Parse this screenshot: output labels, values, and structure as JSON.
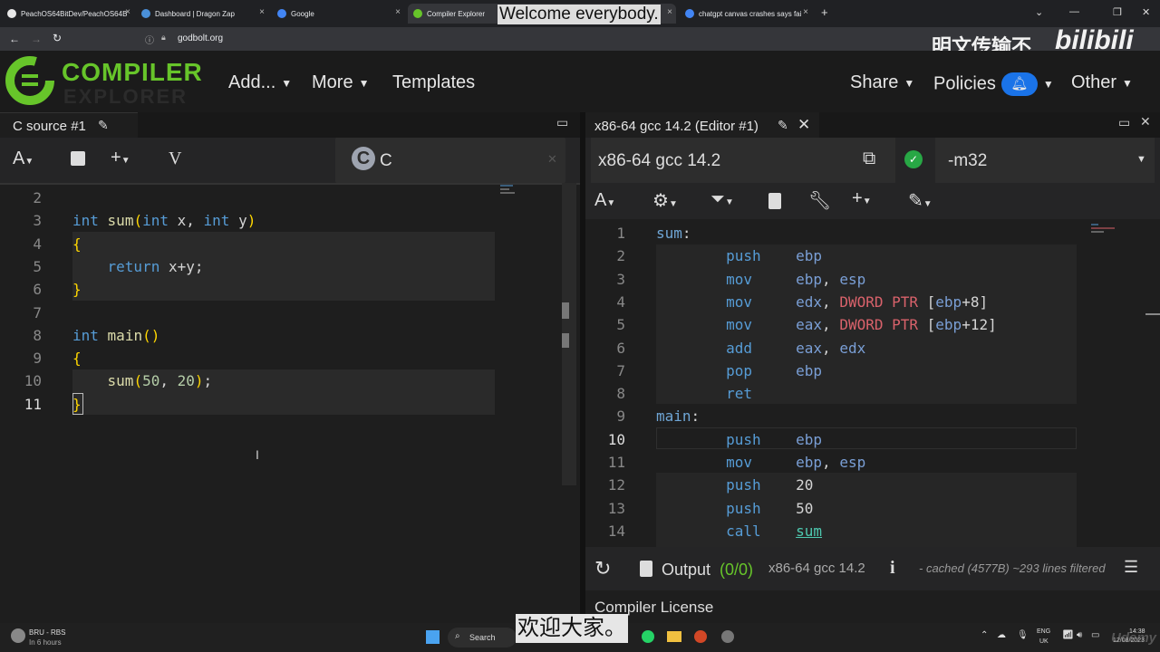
{
  "browser": {
    "tabs": [
      {
        "title": "PeachOS64BitDev/PeachOS64B",
        "fav": "#e8e8e8"
      },
      {
        "title": "Dashboard | Dragon Zap",
        "fav": "#4a90d9"
      },
      {
        "title": "Google",
        "fav": "#4285f4"
      },
      {
        "title": "Compiler Explorer",
        "fav": "#67c52a"
      },
      {
        "title": "chatgpt canvas crashes says fai",
        "fav": "#4285f4"
      }
    ],
    "tab_close": "×",
    "new_tab": "+",
    "url": "godbolt.org",
    "window_controls": [
      "⌄",
      "—",
      "❐",
      "✕"
    ]
  },
  "subtitle_top": "Welcome everybody.",
  "watermark": "明文传输不",
  "watermark_logo": "bilibili",
  "header": {
    "logo_text": "COMPILER",
    "logo_sub": "EXPLORER",
    "menus": [
      "Add...",
      "More",
      "Templates"
    ],
    "right_menus": [
      "Share",
      "Policies",
      "Other"
    ]
  },
  "source_pane": {
    "title": "C source #1",
    "language": "C",
    "language_icon": "C",
    "lines": [
      {
        "n": "2",
        "html": ""
      },
      {
        "n": "3",
        "html": "<span class='kw'>int</span> <span class='fn'>sum</span><span class='br'>(</span><span class='kw'>int</span> x, <span class='kw'>int</span> y<span class='br'>)</span>"
      },
      {
        "n": "4",
        "html": "<span class='br'>{</span>"
      },
      {
        "n": "5",
        "html": "    <span class='kw'>return</span> x+y;"
      },
      {
        "n": "6",
        "html": "<span class='br'>}</span>"
      },
      {
        "n": "7",
        "html": ""
      },
      {
        "n": "8",
        "html": "<span class='kw'>int</span> <span class='fn'>main</span><span class='br'>()</span>"
      },
      {
        "n": "9",
        "html": "<span class='br'>{</span>"
      },
      {
        "n": "10",
        "html": "    <span class='fn'>sum</span><span class='br'>(</span><span class='num'>50</span>, <span class='num'>20</span><span class='br'>)</span>;"
      },
      {
        "n": "11",
        "html": "<span class='br'>}</span>"
      }
    ]
  },
  "asm_pane": {
    "title": "x86-64 gcc 14.2 (Editor #1)",
    "compiler": "x86-64 gcc 14.2",
    "flags": "-m32",
    "lines": [
      {
        "n": "1",
        "html": "<span class='lbl'>sum</span>:"
      },
      {
        "n": "2",
        "html": "        <span class='ins'>push</span>    <span class='reg'>ebp</span>"
      },
      {
        "n": "3",
        "html": "        <span class='ins'>mov</span>     <span class='reg'>ebp</span>, <span class='reg'>esp</span>"
      },
      {
        "n": "4",
        "html": "        <span class='ins'>mov</span>     <span class='reg'>edx</span>, <span class='ptr'>DWORD PTR</span> [<span class='reg'>ebp</span>+8]"
      },
      {
        "n": "5",
        "html": "        <span class='ins'>mov</span>     <span class='reg'>eax</span>, <span class='ptr'>DWORD PTR</span> [<span class='reg'>ebp</span>+12]"
      },
      {
        "n": "6",
        "html": "        <span class='ins'>add</span>     <span class='reg'>eax</span>, <span class='reg'>edx</span>"
      },
      {
        "n": "7",
        "html": "        <span class='ins'>pop</span>     <span class='reg'>ebp</span>"
      },
      {
        "n": "8",
        "html": "        <span class='ins'>ret</span>"
      },
      {
        "n": "9",
        "html": "<span class='lbl'>main</span>:"
      },
      {
        "n": "10",
        "html": "        <span class='ins'>push</span>    <span class='reg'>ebp</span>"
      },
      {
        "n": "11",
        "html": "        <span class='ins'>mov</span>     <span class='reg'>ebp</span>, <span class='reg'>esp</span>"
      },
      {
        "n": "12",
        "html": "        <span class='ins'>push</span>    20"
      },
      {
        "n": "13",
        "html": "        <span class='ins'>push</span>    50"
      },
      {
        "n": "14",
        "html": "        <span class='ins'>call</span>    <span style='color:#4ec9b0;text-decoration:underline'>sum</span>"
      }
    ],
    "output_label": "Output",
    "output_count": "(0/0)",
    "output_compiler": "x86-64 gcc 14.2",
    "cached": "- cached (4577B) ~293 lines filtered",
    "license": "Compiler License"
  },
  "taskbar": {
    "weather_title": "BRU - RBS",
    "weather_sub": "In 6 hours",
    "search": "Search",
    "lang": "ENG",
    "region": "UK",
    "time": "14:38",
    "date": "12/08/2023",
    "brand": "Udemy"
  },
  "subtitle_bottom": "欢迎大家。"
}
